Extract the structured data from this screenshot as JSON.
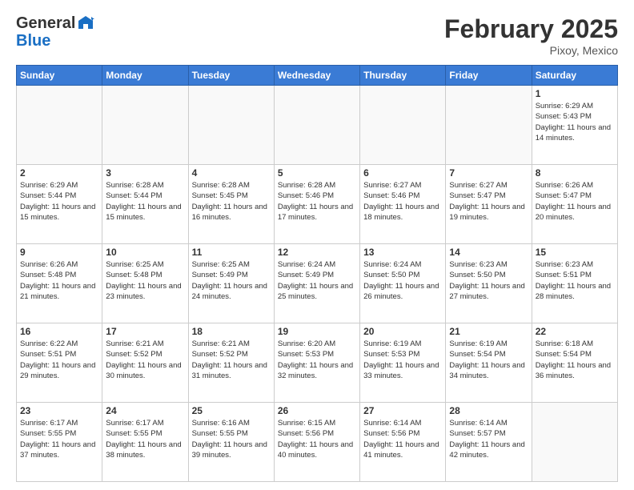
{
  "header": {
    "logo_general": "General",
    "logo_blue": "Blue",
    "month": "February 2025",
    "location": "Pixoy, Mexico"
  },
  "days_of_week": [
    "Sunday",
    "Monday",
    "Tuesday",
    "Wednesday",
    "Thursday",
    "Friday",
    "Saturday"
  ],
  "weeks": [
    [
      {
        "day": "",
        "info": ""
      },
      {
        "day": "",
        "info": ""
      },
      {
        "day": "",
        "info": ""
      },
      {
        "day": "",
        "info": ""
      },
      {
        "day": "",
        "info": ""
      },
      {
        "day": "",
        "info": ""
      },
      {
        "day": "1",
        "info": "Sunrise: 6:29 AM\nSunset: 5:43 PM\nDaylight: 11 hours and 14 minutes."
      }
    ],
    [
      {
        "day": "2",
        "info": "Sunrise: 6:29 AM\nSunset: 5:44 PM\nDaylight: 11 hours and 15 minutes."
      },
      {
        "day": "3",
        "info": "Sunrise: 6:28 AM\nSunset: 5:44 PM\nDaylight: 11 hours and 15 minutes."
      },
      {
        "day": "4",
        "info": "Sunrise: 6:28 AM\nSunset: 5:45 PM\nDaylight: 11 hours and 16 minutes."
      },
      {
        "day": "5",
        "info": "Sunrise: 6:28 AM\nSunset: 5:46 PM\nDaylight: 11 hours and 17 minutes."
      },
      {
        "day": "6",
        "info": "Sunrise: 6:27 AM\nSunset: 5:46 PM\nDaylight: 11 hours and 18 minutes."
      },
      {
        "day": "7",
        "info": "Sunrise: 6:27 AM\nSunset: 5:47 PM\nDaylight: 11 hours and 19 minutes."
      },
      {
        "day": "8",
        "info": "Sunrise: 6:26 AM\nSunset: 5:47 PM\nDaylight: 11 hours and 20 minutes."
      }
    ],
    [
      {
        "day": "9",
        "info": "Sunrise: 6:26 AM\nSunset: 5:48 PM\nDaylight: 11 hours and 21 minutes."
      },
      {
        "day": "10",
        "info": "Sunrise: 6:25 AM\nSunset: 5:48 PM\nDaylight: 11 hours and 23 minutes."
      },
      {
        "day": "11",
        "info": "Sunrise: 6:25 AM\nSunset: 5:49 PM\nDaylight: 11 hours and 24 minutes."
      },
      {
        "day": "12",
        "info": "Sunrise: 6:24 AM\nSunset: 5:49 PM\nDaylight: 11 hours and 25 minutes."
      },
      {
        "day": "13",
        "info": "Sunrise: 6:24 AM\nSunset: 5:50 PM\nDaylight: 11 hours and 26 minutes."
      },
      {
        "day": "14",
        "info": "Sunrise: 6:23 AM\nSunset: 5:50 PM\nDaylight: 11 hours and 27 minutes."
      },
      {
        "day": "15",
        "info": "Sunrise: 6:23 AM\nSunset: 5:51 PM\nDaylight: 11 hours and 28 minutes."
      }
    ],
    [
      {
        "day": "16",
        "info": "Sunrise: 6:22 AM\nSunset: 5:51 PM\nDaylight: 11 hours and 29 minutes."
      },
      {
        "day": "17",
        "info": "Sunrise: 6:21 AM\nSunset: 5:52 PM\nDaylight: 11 hours and 30 minutes."
      },
      {
        "day": "18",
        "info": "Sunrise: 6:21 AM\nSunset: 5:52 PM\nDaylight: 11 hours and 31 minutes."
      },
      {
        "day": "19",
        "info": "Sunrise: 6:20 AM\nSunset: 5:53 PM\nDaylight: 11 hours and 32 minutes."
      },
      {
        "day": "20",
        "info": "Sunrise: 6:19 AM\nSunset: 5:53 PM\nDaylight: 11 hours and 33 minutes."
      },
      {
        "day": "21",
        "info": "Sunrise: 6:19 AM\nSunset: 5:54 PM\nDaylight: 11 hours and 34 minutes."
      },
      {
        "day": "22",
        "info": "Sunrise: 6:18 AM\nSunset: 5:54 PM\nDaylight: 11 hours and 36 minutes."
      }
    ],
    [
      {
        "day": "23",
        "info": "Sunrise: 6:17 AM\nSunset: 5:55 PM\nDaylight: 11 hours and 37 minutes."
      },
      {
        "day": "24",
        "info": "Sunrise: 6:17 AM\nSunset: 5:55 PM\nDaylight: 11 hours and 38 minutes."
      },
      {
        "day": "25",
        "info": "Sunrise: 6:16 AM\nSunset: 5:55 PM\nDaylight: 11 hours and 39 minutes."
      },
      {
        "day": "26",
        "info": "Sunrise: 6:15 AM\nSunset: 5:56 PM\nDaylight: 11 hours and 40 minutes."
      },
      {
        "day": "27",
        "info": "Sunrise: 6:14 AM\nSunset: 5:56 PM\nDaylight: 11 hours and 41 minutes."
      },
      {
        "day": "28",
        "info": "Sunrise: 6:14 AM\nSunset: 5:57 PM\nDaylight: 11 hours and 42 minutes."
      },
      {
        "day": "",
        "info": ""
      }
    ]
  ]
}
